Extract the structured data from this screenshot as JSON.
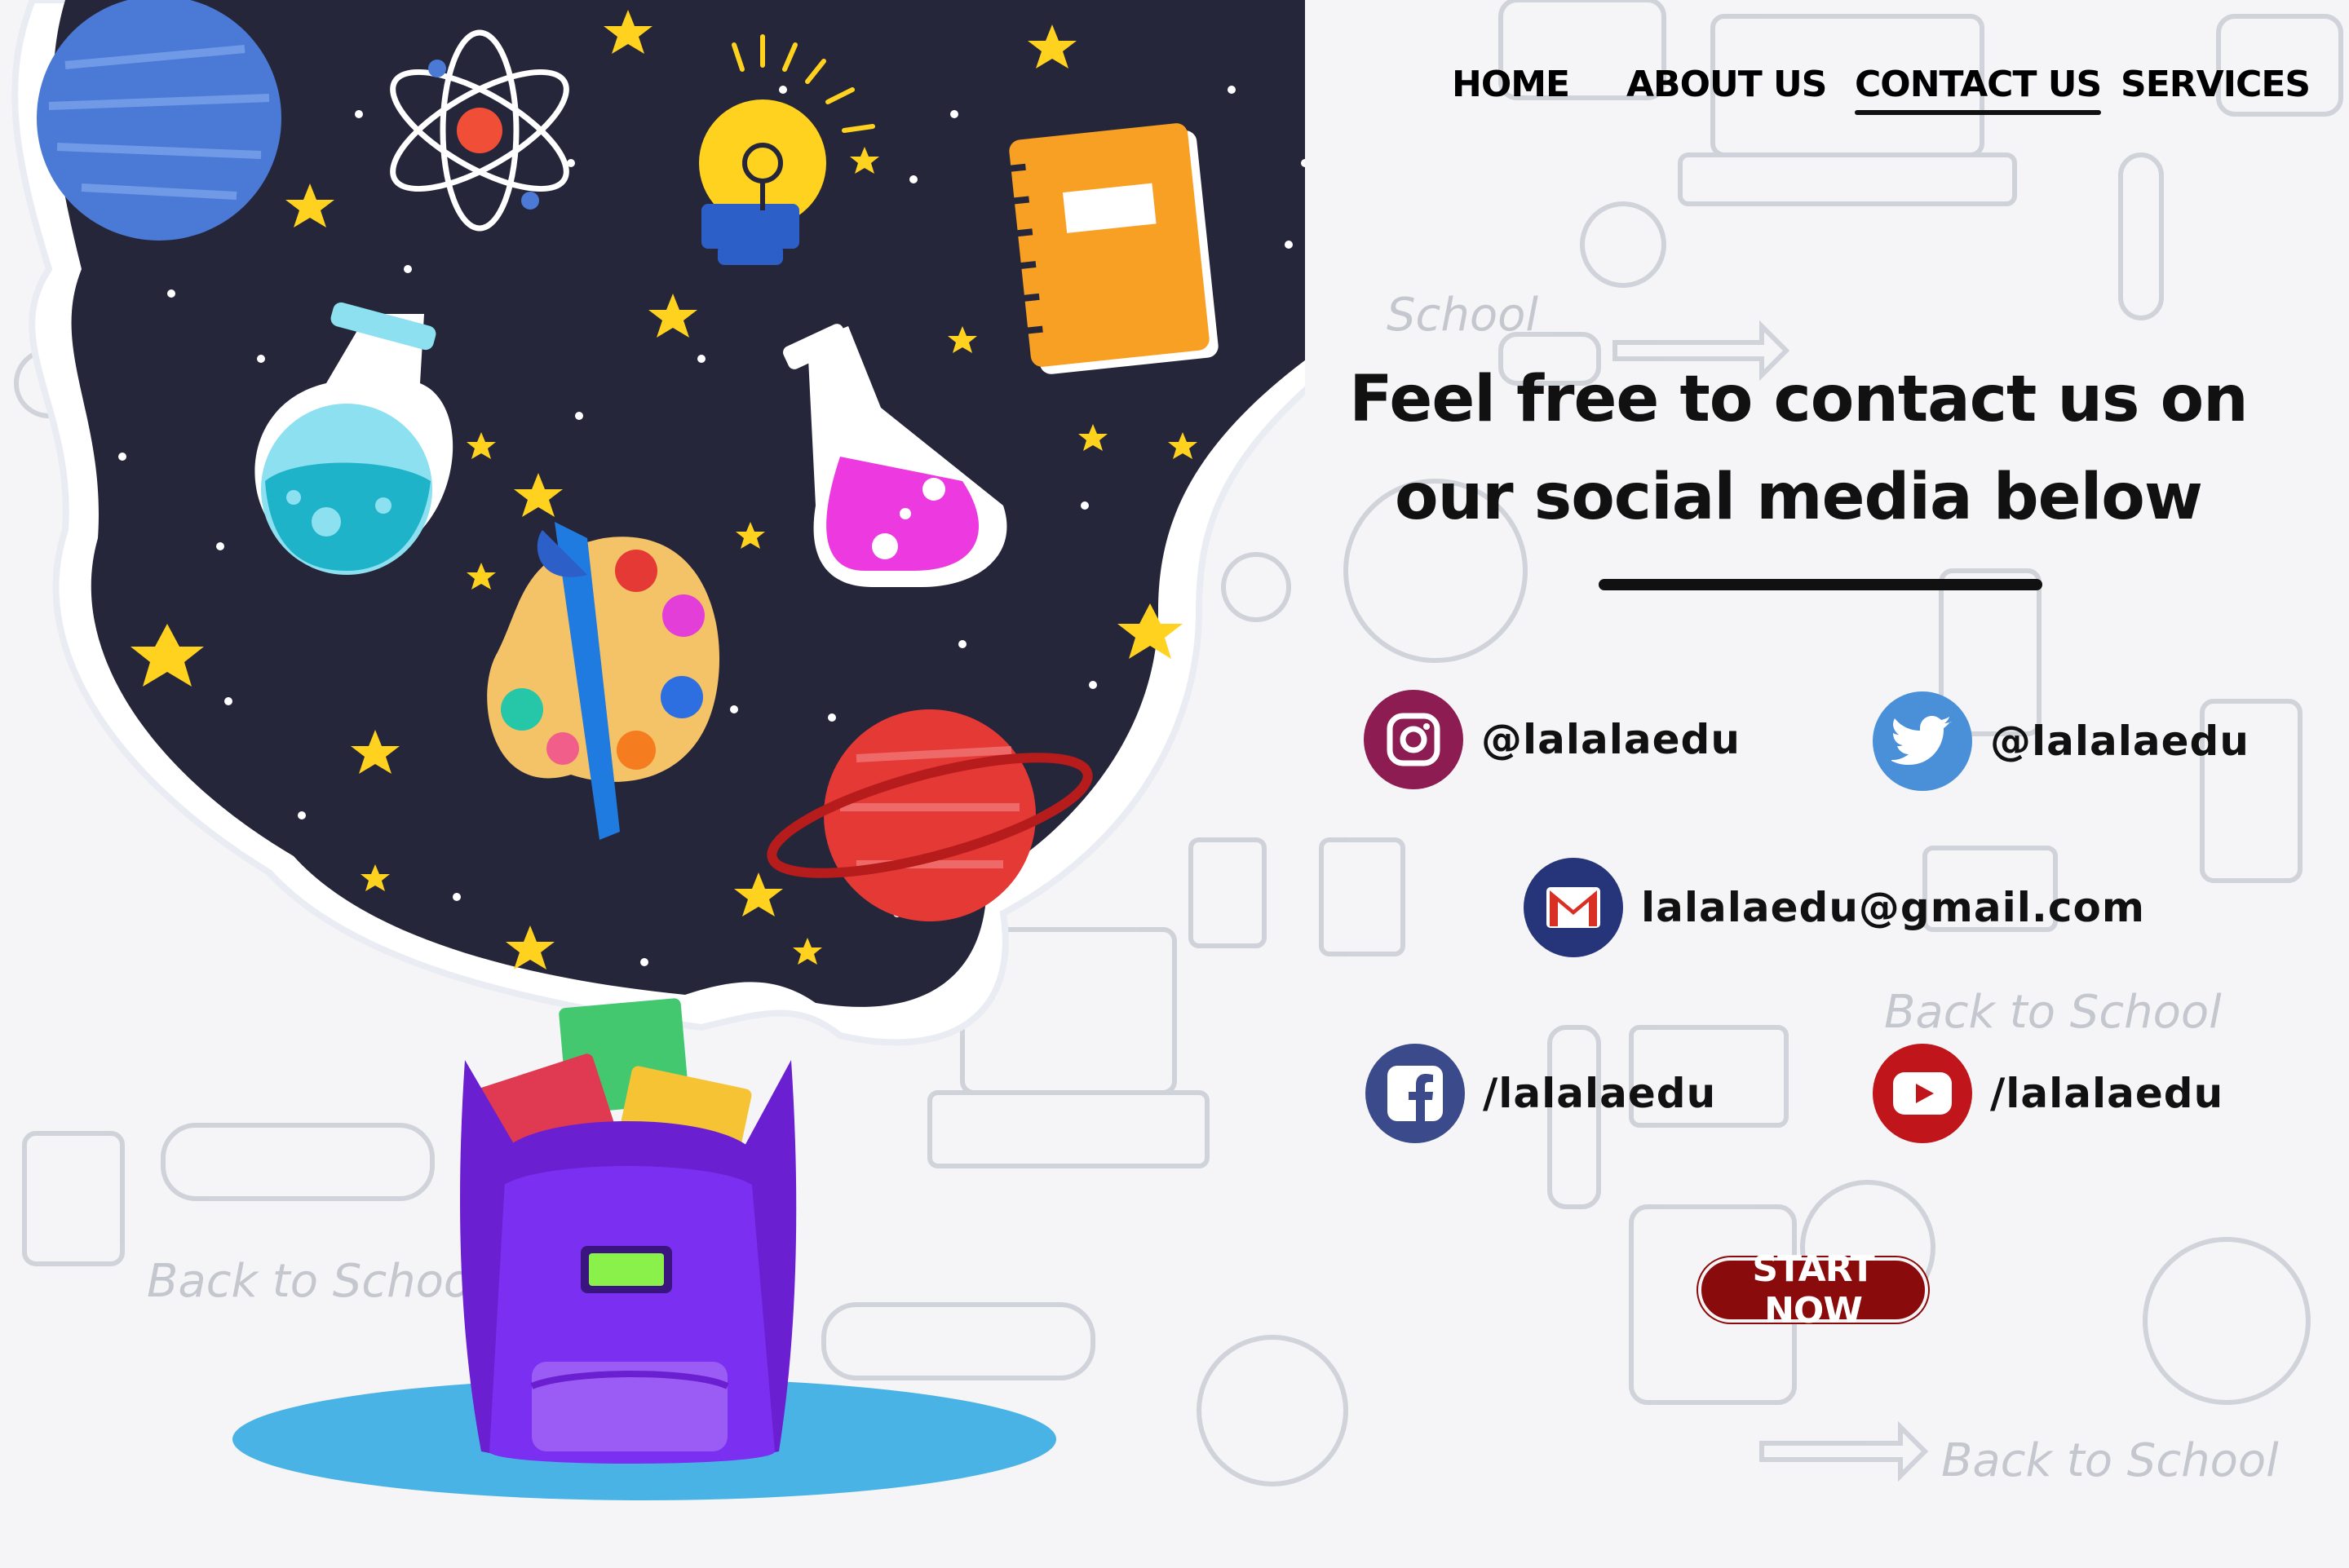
{
  "nav": {
    "items": [
      {
        "label": "HOME",
        "active": false
      },
      {
        "label": "ABOUT US",
        "active": false
      },
      {
        "label": "CONTACT US",
        "active": true
      },
      {
        "label": "SERVICES",
        "active": false
      }
    ]
  },
  "hero": {
    "line1": "Feel free to contact us on",
    "line2": "our social media below"
  },
  "socials": {
    "instagram": {
      "label": "@lalalaedu",
      "icon": "instagram-icon",
      "color": "#8c1c52"
    },
    "twitter": {
      "label": "@lalalaedu",
      "icon": "twitter-icon",
      "color": "#4a90d9"
    },
    "gmail": {
      "label": "lalalaedu@gmail.com",
      "icon": "gmail-icon",
      "color": "#26357a"
    },
    "facebook": {
      "label": "/lalalaedu",
      "icon": "facebook-icon",
      "color": "#3b4a8a"
    },
    "youtube": {
      "label": "/lalalaedu",
      "icon": "youtube-icon",
      "color": "#c0161b"
    }
  },
  "cta": {
    "label": "START NOW",
    "color": "#8a0b0b"
  },
  "background_doodles": [
    "Back to School",
    "Back to School",
    "Back to School",
    "School"
  ],
  "colors": {
    "space": "#26263a",
    "backpack": "#6a1fd0",
    "shadow": "#4ab3e6"
  }
}
